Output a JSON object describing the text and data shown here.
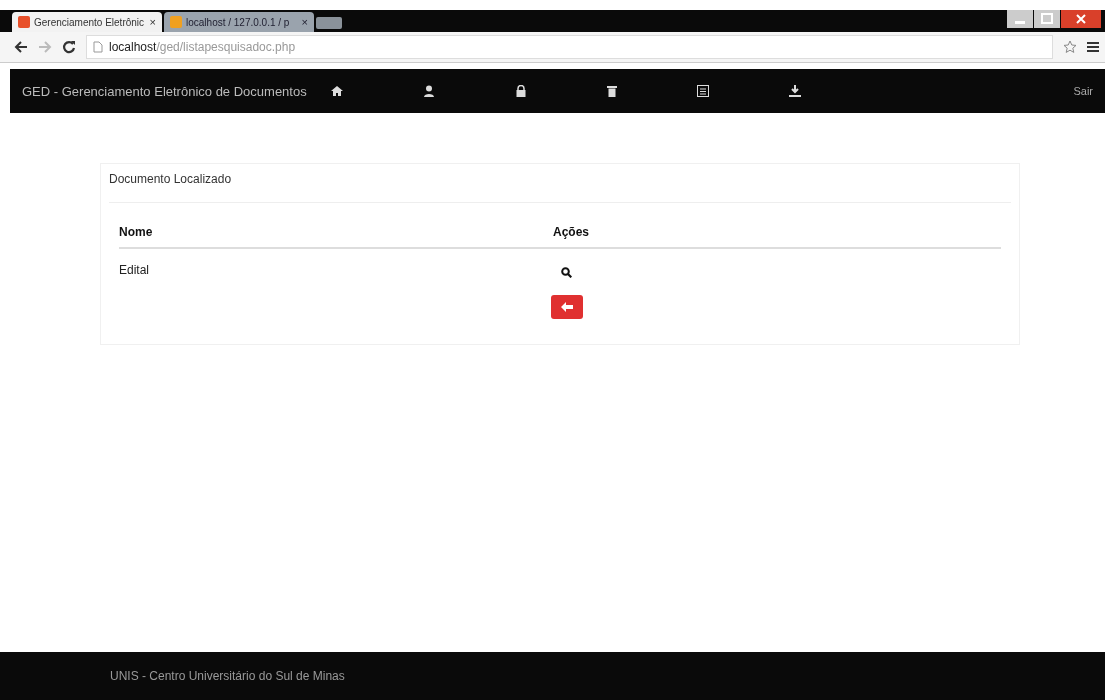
{
  "browser": {
    "tabs": [
      {
        "title": "Gerenciamento Eletrônic",
        "close": "×",
        "selected": true
      },
      {
        "title": "localhost / 127.0.0.1 / p",
        "close": "×",
        "selected": false
      }
    ],
    "address": {
      "host": "localhost",
      "path": "/ged/listapesquisadoc.php"
    }
  },
  "navbar": {
    "brand": "GED - Gerenciamento Eletrônico de Documentos",
    "items": [
      {
        "kind": "home"
      },
      {
        "kind": "user"
      },
      {
        "kind": "lock"
      },
      {
        "kind": "trash"
      },
      {
        "kind": "list"
      },
      {
        "kind": "download"
      }
    ],
    "logout": "Sair"
  },
  "panel": {
    "title": "Documento Localizado",
    "table": {
      "columns": [
        "Nome",
        "Ações"
      ],
      "rows": [
        {
          "name": "Edital"
        }
      ]
    }
  },
  "footer": "UNIS - Centro Universitário do Sul de Minas"
}
